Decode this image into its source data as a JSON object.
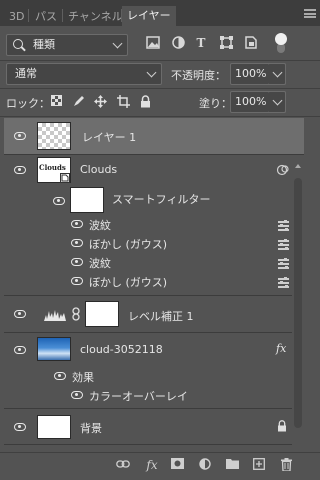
{
  "tabs": [
    {
      "label": "3D",
      "active": false
    },
    {
      "label": "パス",
      "active": false
    },
    {
      "label": "チャンネル",
      "active": false
    },
    {
      "label": "レイヤー",
      "active": true
    }
  ],
  "filter": {
    "search_icon": "search-icon",
    "kind_label": "種類",
    "icons": [
      "image-filter-icon",
      "adjustment-filter-icon",
      "type-filter-icon",
      "shape-filter-icon",
      "smart-object-filter-icon"
    ]
  },
  "blend": {
    "mode": "通常",
    "opacity_label": "不透明度：",
    "opacity_value": "100%",
    "fill_label": "塗り：",
    "fill_value": "100%"
  },
  "lock": {
    "label": "ロック：",
    "icons": [
      "lock-transparent-icon",
      "lock-paint-icon",
      "lock-move-icon",
      "lock-artboard-icon",
      "lock-all-icon"
    ]
  },
  "layers": {
    "layer1": {
      "name": "レイヤー 1",
      "selected": true
    },
    "clouds": {
      "name": "Clouds",
      "thumb_text": "Clouds",
      "smart_filter_label": "スマートフィルター",
      "filters": [
        "波紋",
        "ぼかし (ガウス)",
        "波紋",
        "ぼかし (ガウス)"
      ]
    },
    "levels": {
      "name": "レベル補正 1"
    },
    "cloud_image": {
      "name": "cloud-3052118",
      "fx": "fx",
      "effects_label": "効果",
      "effect_item": "カラーオーバーレイ"
    },
    "background": {
      "name": "背景"
    }
  },
  "bottom": {
    "fx": "fx",
    "icons": [
      "link-layers-icon",
      "layer-style-icon",
      "layer-mask-icon",
      "adjustment-layer-icon",
      "group-folder-icon",
      "new-layer-icon",
      "trash-icon"
    ]
  },
  "colors": {
    "panel": "#535353",
    "tab_bar": "#3d3d3d",
    "selected_row": "#6e6e6e"
  }
}
